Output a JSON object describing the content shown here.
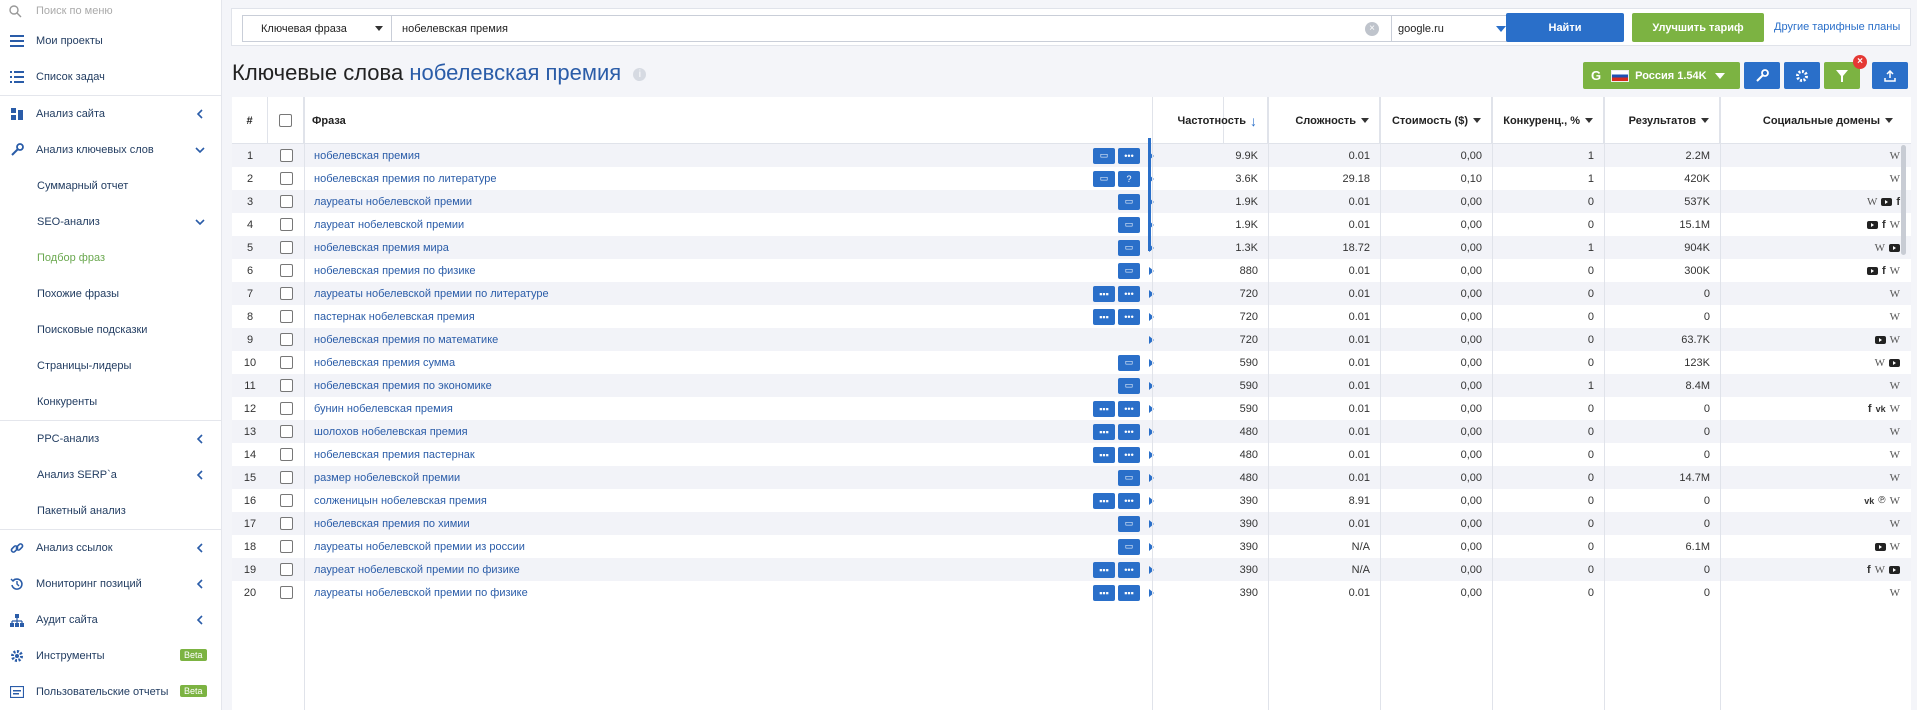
{
  "sidebar": {
    "search_placeholder": "Поиск по меню",
    "items": [
      {
        "label": "Мои проекты"
      },
      {
        "label": "Список задач"
      },
      {
        "label": "Анализ сайта"
      },
      {
        "label": "Анализ ключевых слов"
      },
      {
        "label": "Суммарный отчет"
      },
      {
        "label": "SEO-анализ"
      },
      {
        "label": "Подбор фраз"
      },
      {
        "label": "Похожие фразы"
      },
      {
        "label": "Поисковые подсказки"
      },
      {
        "label": "Страницы-лидеры"
      },
      {
        "label": "Конкуренты"
      },
      {
        "label": "PPC-анализ"
      },
      {
        "label": "Анализ SERP`a"
      },
      {
        "label": "Пакетный анализ"
      },
      {
        "label": "Анализ ссылок"
      },
      {
        "label": "Мониторинг позиций"
      },
      {
        "label": "Аудит сайта"
      },
      {
        "label": "Инструменты"
      },
      {
        "label": "Пользовательские отчеты"
      }
    ],
    "beta_label": "Beta"
  },
  "search": {
    "type_label": "Ключевая фраза",
    "query_value": "нобелевская премия",
    "engine": "google.ru",
    "find_label": "Найти",
    "upgrade_label": "Улучшить тариф",
    "plans_link": "Другие тарифные планы"
  },
  "header": {
    "title_prefix": "Ключевые слова",
    "title_query": "нобелевская премия",
    "region_letter": "G",
    "region_label": "Россия 1.54K"
  },
  "table": {
    "columns": {
      "num": "#",
      "phrase": "Фраза",
      "freq": "Частотность",
      "difficulty": "Сложность",
      "cost": "Стоимость ($)",
      "competition": "Конкуренц., %",
      "results": "Результатов",
      "social": "Социальные домены"
    },
    "rows": [
      {
        "n": "1",
        "phrase": "нобелевская премия",
        "freq": "9.9K",
        "diff": "0.01",
        "cost": "0,00",
        "comp": "1",
        "res": "2.2M",
        "social": [
          "w"
        ],
        "acts": [
          "chat",
          "more"
        ]
      },
      {
        "n": "2",
        "phrase": "нобелевская премия по литературе",
        "freq": "3.6K",
        "diff": "29.18",
        "cost": "0,10",
        "comp": "1",
        "res": "420K",
        "social": [
          "w"
        ],
        "acts": [
          "chat",
          "q"
        ]
      },
      {
        "n": "3",
        "phrase": "лауреаты нобелевской премии",
        "freq": "1.9K",
        "diff": "0.01",
        "cost": "0,00",
        "comp": "0",
        "res": "537K",
        "social": [
          "w",
          "yt",
          "f"
        ],
        "acts": [
          "chat"
        ]
      },
      {
        "n": "4",
        "phrase": "лауреат нобелевской премии",
        "freq": "1.9K",
        "diff": "0.01",
        "cost": "0,00",
        "comp": "0",
        "res": "15.1M",
        "social": [
          "yt",
          "f",
          "w"
        ],
        "acts": [
          "chat"
        ]
      },
      {
        "n": "5",
        "phrase": "нобелевская премия мира",
        "freq": "1.3K",
        "diff": "18.72",
        "cost": "0,00",
        "comp": "1",
        "res": "904K",
        "social": [
          "w",
          "yt"
        ],
        "acts": [
          "chat"
        ]
      },
      {
        "n": "6",
        "phrase": "нобелевская премия по физике",
        "freq": "880",
        "diff": "0.01",
        "cost": "0,00",
        "comp": "0",
        "res": "300K",
        "social": [
          "yt",
          "f",
          "w"
        ],
        "acts": [
          "chat"
        ]
      },
      {
        "n": "7",
        "phrase": "лауреаты нобелевской премии по литературе",
        "freq": "720",
        "diff": "0.01",
        "cost": "0,00",
        "comp": "0",
        "res": "0",
        "social": [
          "w"
        ],
        "acts": [
          "grid",
          "more"
        ]
      },
      {
        "n": "8",
        "phrase": "пастернак нобелевская премия",
        "freq": "720",
        "diff": "0.01",
        "cost": "0,00",
        "comp": "0",
        "res": "0",
        "social": [
          "w"
        ],
        "acts": [
          "grid",
          "more"
        ]
      },
      {
        "n": "9",
        "phrase": "нобелевская премия по математике",
        "freq": "720",
        "diff": "0.01",
        "cost": "0,00",
        "comp": "0",
        "res": "63.7K",
        "social": [
          "yt",
          "w"
        ],
        "acts": []
      },
      {
        "n": "10",
        "phrase": "нобелевская премия сумма",
        "freq": "590",
        "diff": "0.01",
        "cost": "0,00",
        "comp": "0",
        "res": "123K",
        "social": [
          "w",
          "yt"
        ],
        "acts": [
          "chat"
        ]
      },
      {
        "n": "11",
        "phrase": "нобелевская премия по экономике",
        "freq": "590",
        "diff": "0.01",
        "cost": "0,00",
        "comp": "1",
        "res": "8.4M",
        "social": [
          "w"
        ],
        "acts": [
          "chat"
        ]
      },
      {
        "n": "12",
        "phrase": "бунин нобелевская премия",
        "freq": "590",
        "diff": "0.01",
        "cost": "0,00",
        "comp": "0",
        "res": "0",
        "social": [
          "f",
          "vk",
          "w"
        ],
        "acts": [
          "grid",
          "more"
        ]
      },
      {
        "n": "13",
        "phrase": "шолохов нобелевская премия",
        "freq": "480",
        "diff": "0.01",
        "cost": "0,00",
        "comp": "0",
        "res": "0",
        "social": [
          "w"
        ],
        "acts": [
          "grid",
          "more"
        ]
      },
      {
        "n": "14",
        "phrase": "нобелевская премия пастернак",
        "freq": "480",
        "diff": "0.01",
        "cost": "0,00",
        "comp": "0",
        "res": "0",
        "social": [
          "w"
        ],
        "acts": [
          "grid",
          "more"
        ]
      },
      {
        "n": "15",
        "phrase": "размер нобелевской премии",
        "freq": "480",
        "diff": "0.01",
        "cost": "0,00",
        "comp": "0",
        "res": "14.7M",
        "social": [
          "w"
        ],
        "acts": [
          "chat"
        ]
      },
      {
        "n": "16",
        "phrase": "солженицын нобелевская премия",
        "freq": "390",
        "diff": "8.91",
        "cost": "0,00",
        "comp": "0",
        "res": "0",
        "social": [
          "vk",
          "pi",
          "w"
        ],
        "acts": [
          "grid",
          "more"
        ]
      },
      {
        "n": "17",
        "phrase": "нобелевская премия по химии",
        "freq": "390",
        "diff": "0.01",
        "cost": "0,00",
        "comp": "0",
        "res": "0",
        "social": [
          "w"
        ],
        "acts": [
          "chat"
        ]
      },
      {
        "n": "18",
        "phrase": "лауреаты нобелевской премии из россии",
        "freq": "390",
        "diff": "N/A",
        "cost": "0,00",
        "comp": "0",
        "res": "6.1M",
        "social": [
          "yt",
          "w"
        ],
        "acts": [
          "chat"
        ]
      },
      {
        "n": "19",
        "phrase": "лауреат нобелевской премии по физике",
        "freq": "390",
        "diff": "N/A",
        "cost": "0,00",
        "comp": "0",
        "res": "0",
        "social": [
          "f",
          "w",
          "yt"
        ],
        "acts": [
          "grid",
          "more"
        ]
      },
      {
        "n": "20",
        "phrase": "лауреаты нобелевской премии по физике",
        "freq": "390",
        "diff": "0.01",
        "cost": "0,00",
        "comp": "0",
        "res": "0",
        "social": [
          "w"
        ],
        "acts": [
          "grid",
          "grid"
        ]
      }
    ]
  },
  "colors": {
    "accent_blue": "#2a6fc9",
    "accent_green": "#7cb342",
    "link_blue": "#2a5ca8",
    "alert_red": "#e53935"
  }
}
